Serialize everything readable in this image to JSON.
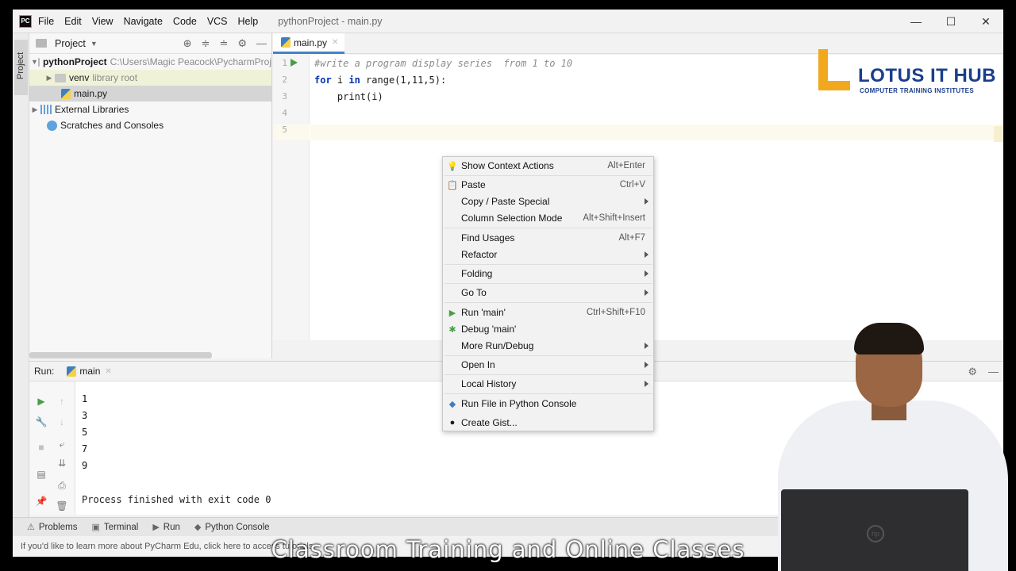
{
  "menubar": {
    "app_logo": "PC",
    "items": [
      "File",
      "Edit",
      "View",
      "Navigate",
      "Code",
      "VCS",
      "Help"
    ],
    "window_title": "pythonProject - main.py"
  },
  "window_controls": {
    "minimize": "—",
    "maximize": "☐",
    "close": "✕"
  },
  "left_stripe": {
    "project": "Project"
  },
  "project_panel": {
    "title": "Project",
    "tree": [
      {
        "label": "pythonProject",
        "hint": "C:\\Users\\Magic Peacock\\PycharmProj"
      },
      {
        "label": "venv",
        "hint": "library root"
      },
      {
        "label": "main.py"
      },
      {
        "label": "External Libraries"
      },
      {
        "label": "Scratches and Consoles"
      }
    ]
  },
  "editor": {
    "tab": "main.py",
    "line_numbers": [
      "1",
      "2",
      "3",
      "4",
      "5"
    ],
    "lines": [
      {
        "comment": "#write a program display series  from 1 to 10"
      },
      {
        "kw1": "for",
        "mid1": " i ",
        "kw2": "in",
        "rest": " range(1,11,5):"
      },
      {
        "text": "    print(i)"
      }
    ]
  },
  "brand": {
    "name": "LOTUS IT HUB",
    "tagline": "COMPUTER TRAINING INSTITUTES"
  },
  "run_panel": {
    "label": "Run:",
    "tab": "main",
    "output": [
      "1",
      "3",
      "5",
      "7",
      "9"
    ],
    "process": "Process finished with exit code 0"
  },
  "bottom_tabs": [
    "Problems",
    "Terminal",
    "Run",
    "Python Console"
  ],
  "status": "If you'd like to learn more about PyCharm Edu, click here to access tutorials",
  "context_menu": [
    {
      "label": "Show Context Actions",
      "shortcut": "Alt+Enter",
      "icon": "bulb-icon"
    },
    {
      "label": "Paste",
      "shortcut": "Ctrl+V",
      "icon": "clipboard-icon"
    },
    {
      "label": "Copy / Paste Special",
      "submenu": true
    },
    {
      "label": "Column Selection Mode",
      "shortcut": "Alt+Shift+Insert"
    },
    {
      "label": "Find Usages",
      "shortcut": "Alt+F7"
    },
    {
      "label": "Refactor",
      "submenu": true
    },
    {
      "label": "Folding",
      "submenu": true
    },
    {
      "label": "Go To",
      "submenu": true
    },
    {
      "label": "Run 'main'",
      "shortcut": "Ctrl+Shift+F10",
      "icon": "run-icon"
    },
    {
      "label": "Debug 'main'",
      "icon": "debug-icon"
    },
    {
      "label": "More Run/Debug",
      "submenu": true
    },
    {
      "label": "Open In",
      "submenu": true
    },
    {
      "label": "Local History",
      "submenu": true
    },
    {
      "label": "Run File in Python Console",
      "icon": "python-icon"
    },
    {
      "label": "Create Gist...",
      "icon": "github-icon"
    }
  ],
  "subtitle": "Classroom Training and Online Classes",
  "colors": {
    "accent": "#4083c9",
    "run_green": "#4a9e48",
    "brand_blue": "#1a3e8c",
    "brand_orange": "#f2a81d"
  }
}
